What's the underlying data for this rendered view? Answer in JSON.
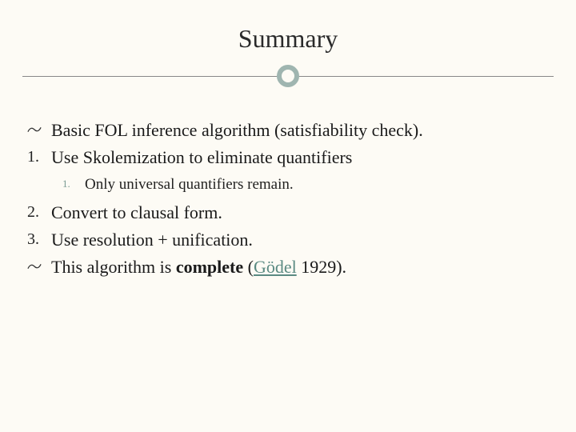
{
  "title": "Summary",
  "items": [
    {
      "marker": "swirl",
      "text": "Basic FOL inference algorithm (satisfiability check)."
    },
    {
      "marker": "1.",
      "text": "Use Skolemization to eliminate quantifiers"
    }
  ],
  "sub": {
    "marker": "1.",
    "text": "Only universal quantifiers remain."
  },
  "items2": [
    {
      "marker": "2.",
      "text": "Convert to clausal form."
    },
    {
      "marker": "3.",
      "text": "Use resolution + unification."
    }
  ],
  "final": {
    "marker": "swirl",
    "prefix": "This algorithm is ",
    "bold": "complete",
    "paren_open": " (",
    "link": "Gödel",
    "year": " 1929)."
  }
}
